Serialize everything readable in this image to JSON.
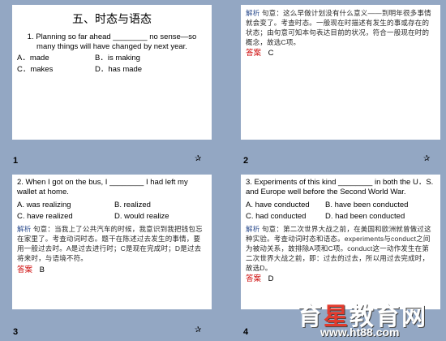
{
  "slides": [
    {
      "number": "1",
      "title": "五、时态与语态",
      "question": "1.  Planning so far ahead ________ no sense—so many things will have changed by next year.",
      "options": [
        [
          "A．made",
          "B．is making"
        ],
        [
          "C．makes",
          "D．has made"
        ]
      ]
    },
    {
      "number": "2",
      "exp_label": "解析",
      "exp_text": "句意：这么早做计划没有什么意义——到明年很多事情就会变了。考查时态。一般现在时描述有发生的事或存在的状态；由句意可知本句表达目前的状况，符合一般现在时的概念，故选C项。",
      "ans_label": "答案",
      "ans_value": "C"
    },
    {
      "number": "3",
      "question": "2.  When I got on the bus, I ________ I had left my wallet at home.",
      "options": [
        [
          "A.  was realizing",
          "B.  realized"
        ],
        [
          "C.  have realized",
          "D.  would realize"
        ]
      ],
      "exp_label": "解析",
      "exp_text": "句意：当我上了公共汽车的时候，我意识到我把钱包忘在家里了。考查动词时态。题干在陈述过去发生的事情，要用一般过去时。A是过去进行时；C是现在完成时；D是过去将来时，与语境不符。",
      "ans_label": "答案",
      "ans_value": "B"
    },
    {
      "number": "4",
      "question": "3.  Experiments of this kind ________ in both the U．S. and Europe well before the Second World War.",
      "options": [
        [
          "A.  have conducted",
          "B.  have been conducted"
        ],
        [
          "C.  had conducted",
          "D.  had been conducted"
        ]
      ],
      "exp_label": "解析",
      "exp_text": "句意：第二次世界大战之前，在美国和欧洲就曾做过这种实验。考查动词时态和语态。experiments与conduct之间为被动关系，故排除A项和C项。conduct这一动作发生在第二次世界大战之前，即：过去的过去，所以用过去完成时，故选D。",
      "ans_label": "答案",
      "ans_value": "D"
    }
  ],
  "trans_icon": "slide-transition-icon",
  "watermark": {
    "cn_a": "育",
    "cn_b": "星",
    "cn_c": "教育网",
    "url": "www.ht88.com"
  }
}
